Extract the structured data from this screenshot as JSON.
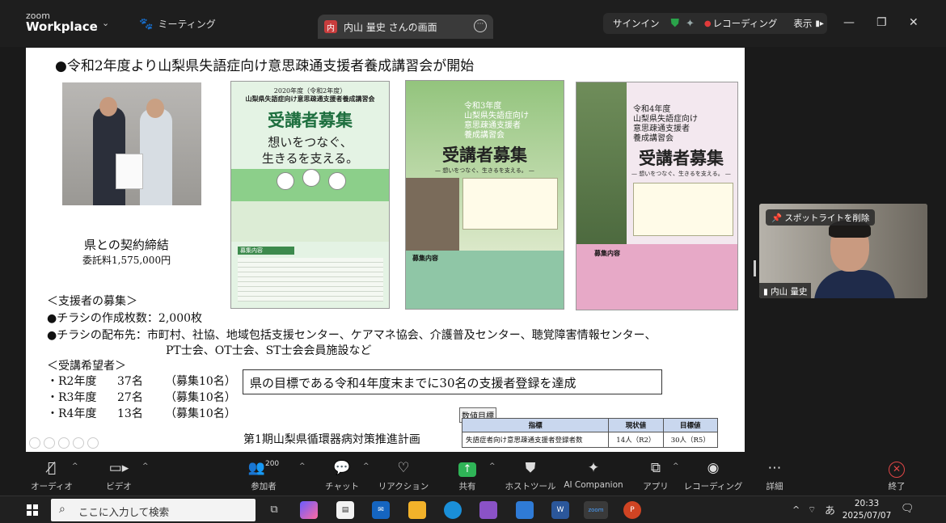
{
  "window": {
    "brand_top": "zoom",
    "brand_name": "Workplace",
    "meeting_label": "ミーティング",
    "share_tab": "内山 量史 さんの画面",
    "share_avatar": "内",
    "signin": "サインイン",
    "recording": "レコーディング",
    "view": "表示"
  },
  "slide": {
    "title": "●令和2年度より山梨県失語症向け意思疎通支援者養成講習会が開始",
    "photo_caption": "県との契約締結",
    "photo_subcaption": "委託料1,575,000円",
    "flyer1": {
      "line1": "2020年度（令和2年度）",
      "line2": "山梨県失語症向け意思疎通支援者養成講習会",
      "heading": "受講者募集",
      "slogan1": "想いをつなぐ、",
      "slogan2": "生きるを支える。",
      "section": "募集内容"
    },
    "flyer2": {
      "line1": "令和3年度",
      "line2": "山梨県失語症向け",
      "line3": "意思疎通支援者",
      "line4": "養成講習会",
      "heading": "受講者募集",
      "slogan": "— 想いをつなぐ、生きるを支える。 —",
      "section": "募集内容"
    },
    "flyer3": {
      "line1": "令和4年度",
      "line2": "山梨県失語症向け",
      "line3": "意思疎通支援者",
      "line4": "養成講習会",
      "heading": "受講者募集",
      "slogan": "— 想いをつなぐ、生きるを支える。 —",
      "section": "募集内容"
    },
    "supporter_header": "＜支援者の募集＞",
    "flyer_count": "●チラシの作成枚数：2,000枚",
    "flyer_dist1": "●チラシの配布先：市町村、社協、地域包括支援センター、ケアマネ協会、介護普及センター、聴覚障害情報センター、",
    "flyer_dist2": "PT士会、OT士会、ST士会会員施設など",
    "applicant_header": "＜受講希望者＞",
    "applicants": [
      {
        "year": "・R2年度",
        "count": "37名",
        "quota": "（募集10名）"
      },
      {
        "year": "・R3年度",
        "count": "27名",
        "quota": "（募集10名）"
      },
      {
        "year": "・R4年度",
        "count": "13名",
        "quota": "（募集10名）"
      }
    ],
    "goal": "県の目標である令和4年度末までに30名の支援者登録を達成",
    "plan": "第1期山梨県循環器病対策推進計画",
    "target_title": "数値目標",
    "target_headers": [
      "指標",
      "現状値",
      "目標値"
    ],
    "target_row": [
      "失語症者向け意思疎通支援者登録者数",
      "14人（R2）",
      "30人（R5）"
    ]
  },
  "participant": {
    "spotlight": "スポットライトを削除",
    "name": "内山 量史"
  },
  "toolbar": {
    "audio": "オーディオ",
    "video": "ビデオ",
    "participants": "参加者",
    "participants_count": "200",
    "chat": "チャット",
    "reactions": "リアクション",
    "share": "共有",
    "host_tools": "ホストツール",
    "ai": "AI Companion",
    "apps": "アプリ",
    "recording": "レコーディング",
    "more": "詳細",
    "end": "終了"
  },
  "taskbar": {
    "search_placeholder": "ここに入力して検索",
    "ime": "あ",
    "time": "20:33",
    "date": "2025/07/07"
  }
}
